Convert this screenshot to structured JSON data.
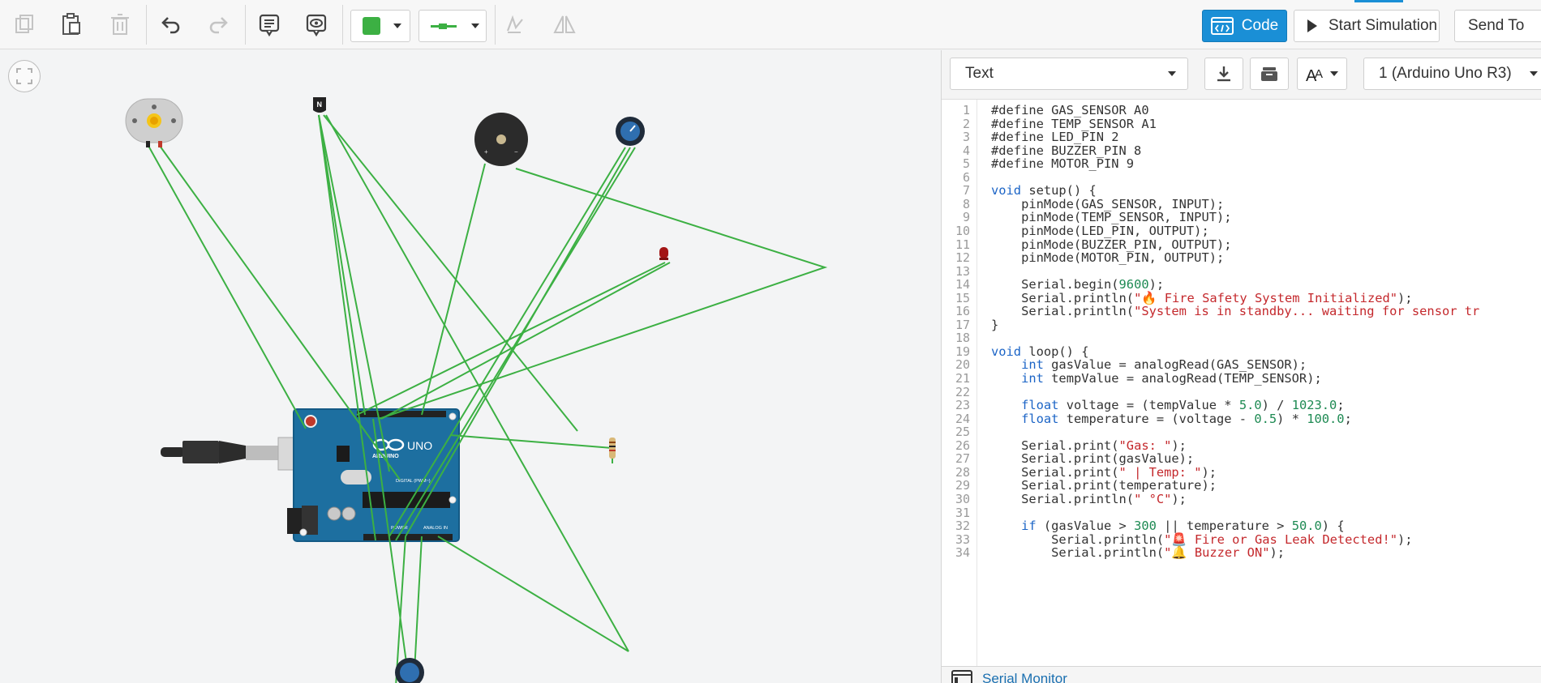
{
  "toolbar": {
    "icons": [
      "copy-icon",
      "paste-icon",
      "delete-icon",
      "undo-icon",
      "redo-icon",
      "note-icon",
      "visibility-icon",
      "color-swatch",
      "line-style",
      "mirror-icon",
      "flip-icon"
    ],
    "wire_color": "#3cb043",
    "code_label": "Code",
    "start_sim_label": "Start Simulation",
    "send_to_label": "Send To",
    "accent": "#1a8fd6"
  },
  "panel": {
    "mode": "Text",
    "board": "1 (Arduino Uno R3)",
    "serial_monitor_label": "Serial Monitor"
  },
  "code": {
    "line_numbers": [
      "1",
      "2",
      "3",
      "4",
      "5",
      "6",
      "7",
      "8",
      "9",
      "10",
      "11",
      "12",
      "13",
      "14",
      "15",
      "16",
      "17",
      "18",
      "19",
      "20",
      "21",
      "22",
      "23",
      "24",
      "25",
      "26",
      "27",
      "28",
      "29",
      "30",
      "31",
      "32",
      "33",
      "34"
    ],
    "lines": [
      "#define GAS_SENSOR A0",
      "#define TEMP_SENSOR A1",
      "#define LED_PIN 2",
      "#define BUZZER_PIN 8",
      "#define MOTOR_PIN 9",
      "",
      "void setup() {",
      "    pinMode(GAS_SENSOR, INPUT);",
      "    pinMode(TEMP_SENSOR, INPUT);",
      "    pinMode(LED_PIN, OUTPUT);",
      "    pinMode(BUZZER_PIN, OUTPUT);",
      "    pinMode(MOTOR_PIN, OUTPUT);",
      "",
      "    Serial.begin(9600);",
      "    Serial.println(\"🔥 Fire Safety System Initialized\");",
      "    Serial.println(\"System is in standby... waiting for sensor tr",
      "}",
      "",
      "void loop() {",
      "    int gasValue = analogRead(GAS_SENSOR);",
      "    int tempValue = analogRead(TEMP_SENSOR);",
      "",
      "    float voltage = (tempValue * 5.0) / 1023.0;",
      "    float temperature = (voltage - 0.5) * 100.0;",
      "",
      "    Serial.print(\"Gas: \");",
      "    Serial.print(gasValue);",
      "    Serial.print(\" | Temp: \");",
      "    Serial.print(temperature);",
      "    Serial.println(\" °C\");",
      "",
      "    if (gasValue > 300 || temperature > 50.0) {",
      "        Serial.println(\"🚨 Fire or Gas Leak Detected!\");",
      "        Serial.println(\"🔔 Buzzer ON\");"
    ]
  },
  "canvas": {
    "components": {
      "motor": "dc-motor",
      "transistor_label": "N",
      "buzzer": "piezo-buzzer",
      "pot_top": "potentiometer",
      "led": "red-led",
      "resistor": "resistor",
      "pot_bottom": "potentiometer",
      "board_brand": "ARDUINO",
      "board_model": "UNO",
      "board_digital_label": "DIGITAL (PWM~)",
      "board_power_label": "POWER",
      "board_analog_label": "ANALOG IN"
    }
  }
}
